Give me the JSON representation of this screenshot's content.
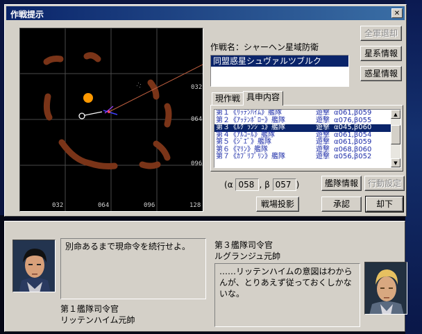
{
  "dialog": {
    "title": "作戦提示",
    "operation_label": "作戦名：",
    "operation_name": "シャーヘン星域防衛",
    "planets": [
      "同盟惑星シュヴァルツブルク"
    ],
    "buttons": {
      "all_retreat": "全軍退却",
      "system_info": "星系情報",
      "planet_info": "惑星情報",
      "fleet_info": "艦隊情報",
      "action_settings": "行動設定",
      "map_projection": "戦場投影",
      "approve": "承認",
      "reject": "却下"
    },
    "tabs": [
      "現作戦",
      "具申内容"
    ],
    "fleets": [
      {
        "name": "第１《ﾘｯﾃﾝﾊｲﾑ》艦隊",
        "action": "遊撃",
        "target": "α061,β059",
        "selected": false
      },
      {
        "name": "第２《ｱｯﾃﾝﾎﾞﾛｰ》艦隊",
        "action": "遊撃",
        "target": "α076,β055",
        "selected": false
      },
      {
        "name": "第３《ﾙｸﾞﾗﾝｼﾞｭ》艦隊",
        "action": "遊撃",
        "target": "α045,β060",
        "selected": true
      },
      {
        "name": "第４《ｱﾙｺｰﾙ》艦隊",
        "action": "遊撃",
        "target": "α061,β054",
        "selected": false
      },
      {
        "name": "第５《ｼﾞｴﾞ》艦隊",
        "action": "遊撃",
        "target": "α061,β059",
        "selected": false
      },
      {
        "name": "第６《ﾏﾘﾝ》艦隊",
        "action": "遊撃",
        "target": "α068,β060",
        "selected": false
      },
      {
        "name": "第７《ｶﾌﾞﾘﾌﾟﾘﾝ》艦隊",
        "action": "遊撃",
        "target": "α056,β052",
        "selected": false
      }
    ],
    "coord": {
      "alpha_symbol": "α",
      "alpha": "058",
      "beta_symbol": "β",
      "beta": "057"
    },
    "map": {
      "x_ticks": [
        "032",
        "064",
        "096",
        "128"
      ],
      "y_ticks": [
        "032",
        "064",
        "096"
      ]
    }
  },
  "messages": {
    "left": {
      "text": "別命あるまで現命令を続行せよ。",
      "speaker_title": "第１艦隊司令官",
      "speaker_name": "リッテンハイム元帥"
    },
    "right": {
      "speaker_title": "第３艦隊司令官",
      "speaker_name": "ルグランジュ元帥",
      "text": "……リッテンハイムの意図はわからんが、とりあえず従っておくしかないな。"
    }
  },
  "colors": {
    "titlebar": "#0a246a",
    "selection": "#0a246a",
    "fleet_text": "#1c2ca8",
    "nebula": "#7a3418",
    "star": "#ff9900"
  }
}
